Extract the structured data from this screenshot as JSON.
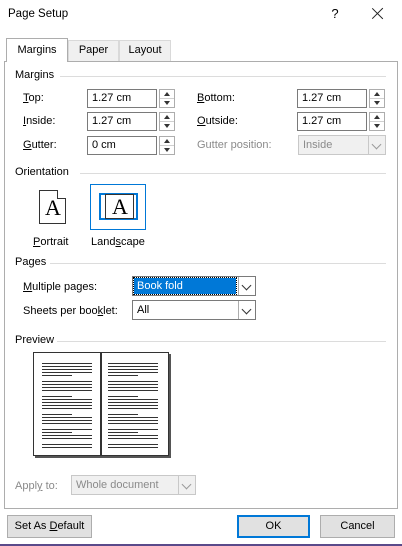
{
  "window": {
    "title": "Page Setup",
    "help_label": "?"
  },
  "tabs": [
    {
      "label": "Margins"
    },
    {
      "label": "Paper"
    },
    {
      "label": "Layout"
    }
  ],
  "margins": {
    "section_label": "Margins",
    "top": {
      "label_accel": "T",
      "label_rest": "op:",
      "value": "1.27 cm"
    },
    "bottom": {
      "label_accel": "B",
      "label_rest": "ottom:",
      "value": "1.27 cm"
    },
    "inside": {
      "label_accel": "I",
      "label_rest": "nside:",
      "value": "1.27 cm"
    },
    "outside": {
      "label_accel": "O",
      "label_rest": "utside:",
      "value": "1.27 cm"
    },
    "gutter": {
      "label_accel": "G",
      "label_rest": "utter:",
      "value": "0 cm"
    },
    "gutter_position": {
      "label": "Gutter position:",
      "value": "Inside"
    }
  },
  "orientation": {
    "section_label": "Orientation",
    "glyph_letter": "A",
    "portrait": {
      "label_accel": "P",
      "label_rest": "ortrait"
    },
    "landscape": {
      "label_before": "Land",
      "label_accel": "s",
      "label_rest": "cape"
    },
    "selected": "landscape"
  },
  "pages": {
    "section_label": "Pages",
    "multiple_pages": {
      "label_accel": "M",
      "label_rest": "ultiple pages:",
      "value": "Book fold"
    },
    "sheets_per_booklet": {
      "label_before": "Sheets per boo",
      "label_accel": "k",
      "label_rest": "let:",
      "value": "All"
    }
  },
  "preview": {
    "section_label": "Preview"
  },
  "apply_to": {
    "label_before": "Appl",
    "label_accel": "y",
    "label_rest": " to:",
    "value": "Whole document"
  },
  "buttons": {
    "set_default_before": "Set As ",
    "set_default_accel": "D",
    "set_default_rest": "efault",
    "ok": "OK",
    "cancel": "Cancel"
  },
  "colors": {
    "accent": "#0078d7",
    "disabled_text": "#8a8a8a"
  }
}
